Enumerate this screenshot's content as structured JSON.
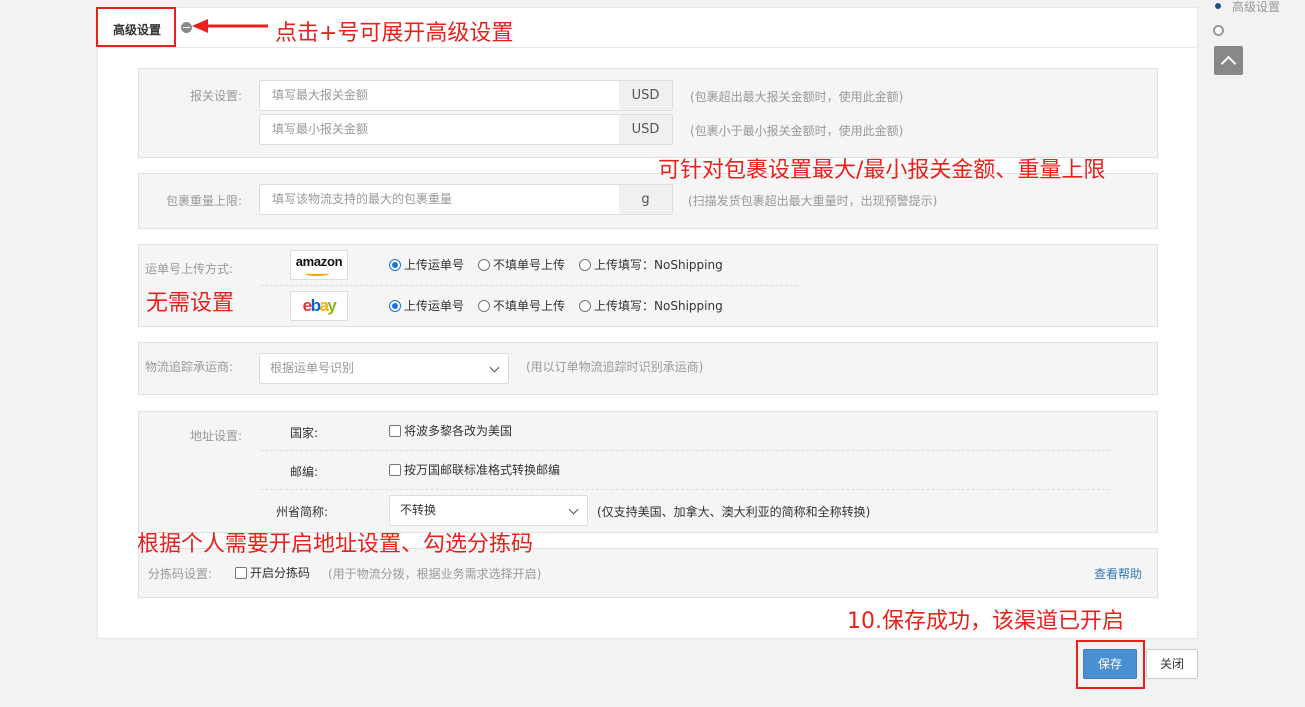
{
  "header": {
    "title": "高级设置",
    "toggle_icon": "minus-circle-icon"
  },
  "declare": {
    "label": "报关设置:",
    "max_placeholder": "填写最大报关金额",
    "min_placeholder": "填写最小报关金额",
    "currency": "USD",
    "max_hint": "(包裹超出最大报关金额时，使用此金额)",
    "min_hint": "(包裹小于最小报关金额时，使用此金额)"
  },
  "weight": {
    "label": "包裹重量上限:",
    "placeholder": "填写该物流支持的最大的包裹重量",
    "unit": "g",
    "hint": "(扫描发货包裹超出最大重量时，出现预警提示)"
  },
  "upload": {
    "label": "运单号上传方式:",
    "platforms": [
      {
        "logo": "amazon",
        "options": [
          "上传运单号",
          "不填单号上传",
          "上传填写：NoShipping"
        ],
        "selected": 0
      },
      {
        "logo": "ebay",
        "options": [
          "上传运单号",
          "不填单号上传",
          "上传填写：NoShipping"
        ],
        "selected": 0
      }
    ]
  },
  "carrier": {
    "label": "物流追踪承运商:",
    "value": "根据运单号识别",
    "hint": "(用以订单物流追踪时识别承运商)"
  },
  "address": {
    "label": "地址设置:",
    "country_label": "国家:",
    "country_option": "将波多黎各改为美国",
    "postcode_label": "邮编:",
    "postcode_option": "按万国邮联标准格式转换邮编",
    "state_label": "州省简称:",
    "state_value": "不转换",
    "state_hint": "(仅支持美国、加拿大、澳大利亚的简称和全称转换)"
  },
  "sorting": {
    "label": "分拣码设置:",
    "option": "开启分拣码",
    "hint": "(用于物流分拨，根据业务需求选择开启)",
    "help_link": "查看帮助"
  },
  "buttons": {
    "save": "保存",
    "close": "关闭"
  },
  "right_nav": {
    "item": "高级设置"
  },
  "annotations": {
    "a1": "点击+号可展开高级设置",
    "a2": "可针对包裹设置最大/最小报关金额、重量上限",
    "a3": "无需设置",
    "a4": "根据个人需要开启地址设置、勾选分拣码",
    "a5": "10.保存成功，该渠道已开启"
  },
  "colors": {
    "annotation": "#e8211d",
    "primary": "#4a8fd4",
    "link": "#337ab7"
  }
}
